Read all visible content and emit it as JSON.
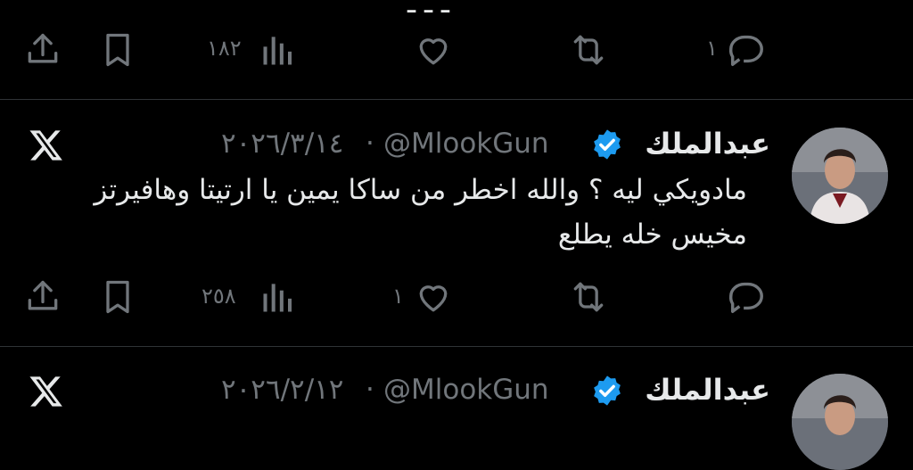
{
  "tweets": [
    {
      "id": "prev",
      "actions": {
        "reply_count": "١",
        "retweet_count": "",
        "like_count": "",
        "views_count": "١٨٢"
      }
    },
    {
      "id": "main",
      "display_name": "عبدالملك",
      "handle": "@MlookGun",
      "date": "٢٠٢٦/٣/١٤",
      "separator": "·",
      "text": "مادويكي ليه ؟ والله اخطر من ساكا يمين يا ارتيتا وهافيرتز مخيس خله يطلع",
      "actions": {
        "reply_count": "",
        "retweet_count": "",
        "like_count": "١",
        "views_count": "٢٥٨"
      }
    },
    {
      "id": "next",
      "display_name": "عبدالملك",
      "handle": "@MlookGun",
      "date": "٢٠٢٦/٢/١٢",
      "separator": "·"
    }
  ],
  "icons": [
    "reply-icon",
    "retweet-icon",
    "like-icon",
    "views-icon",
    "bookmark-icon",
    "share-icon",
    "verified-badge-icon",
    "x-logo-icon"
  ],
  "colors": {
    "background": "#000000",
    "text": "#e7e9ea",
    "muted": "#71767b",
    "verified": "#1d9bf0",
    "divider": "#2f3336"
  }
}
